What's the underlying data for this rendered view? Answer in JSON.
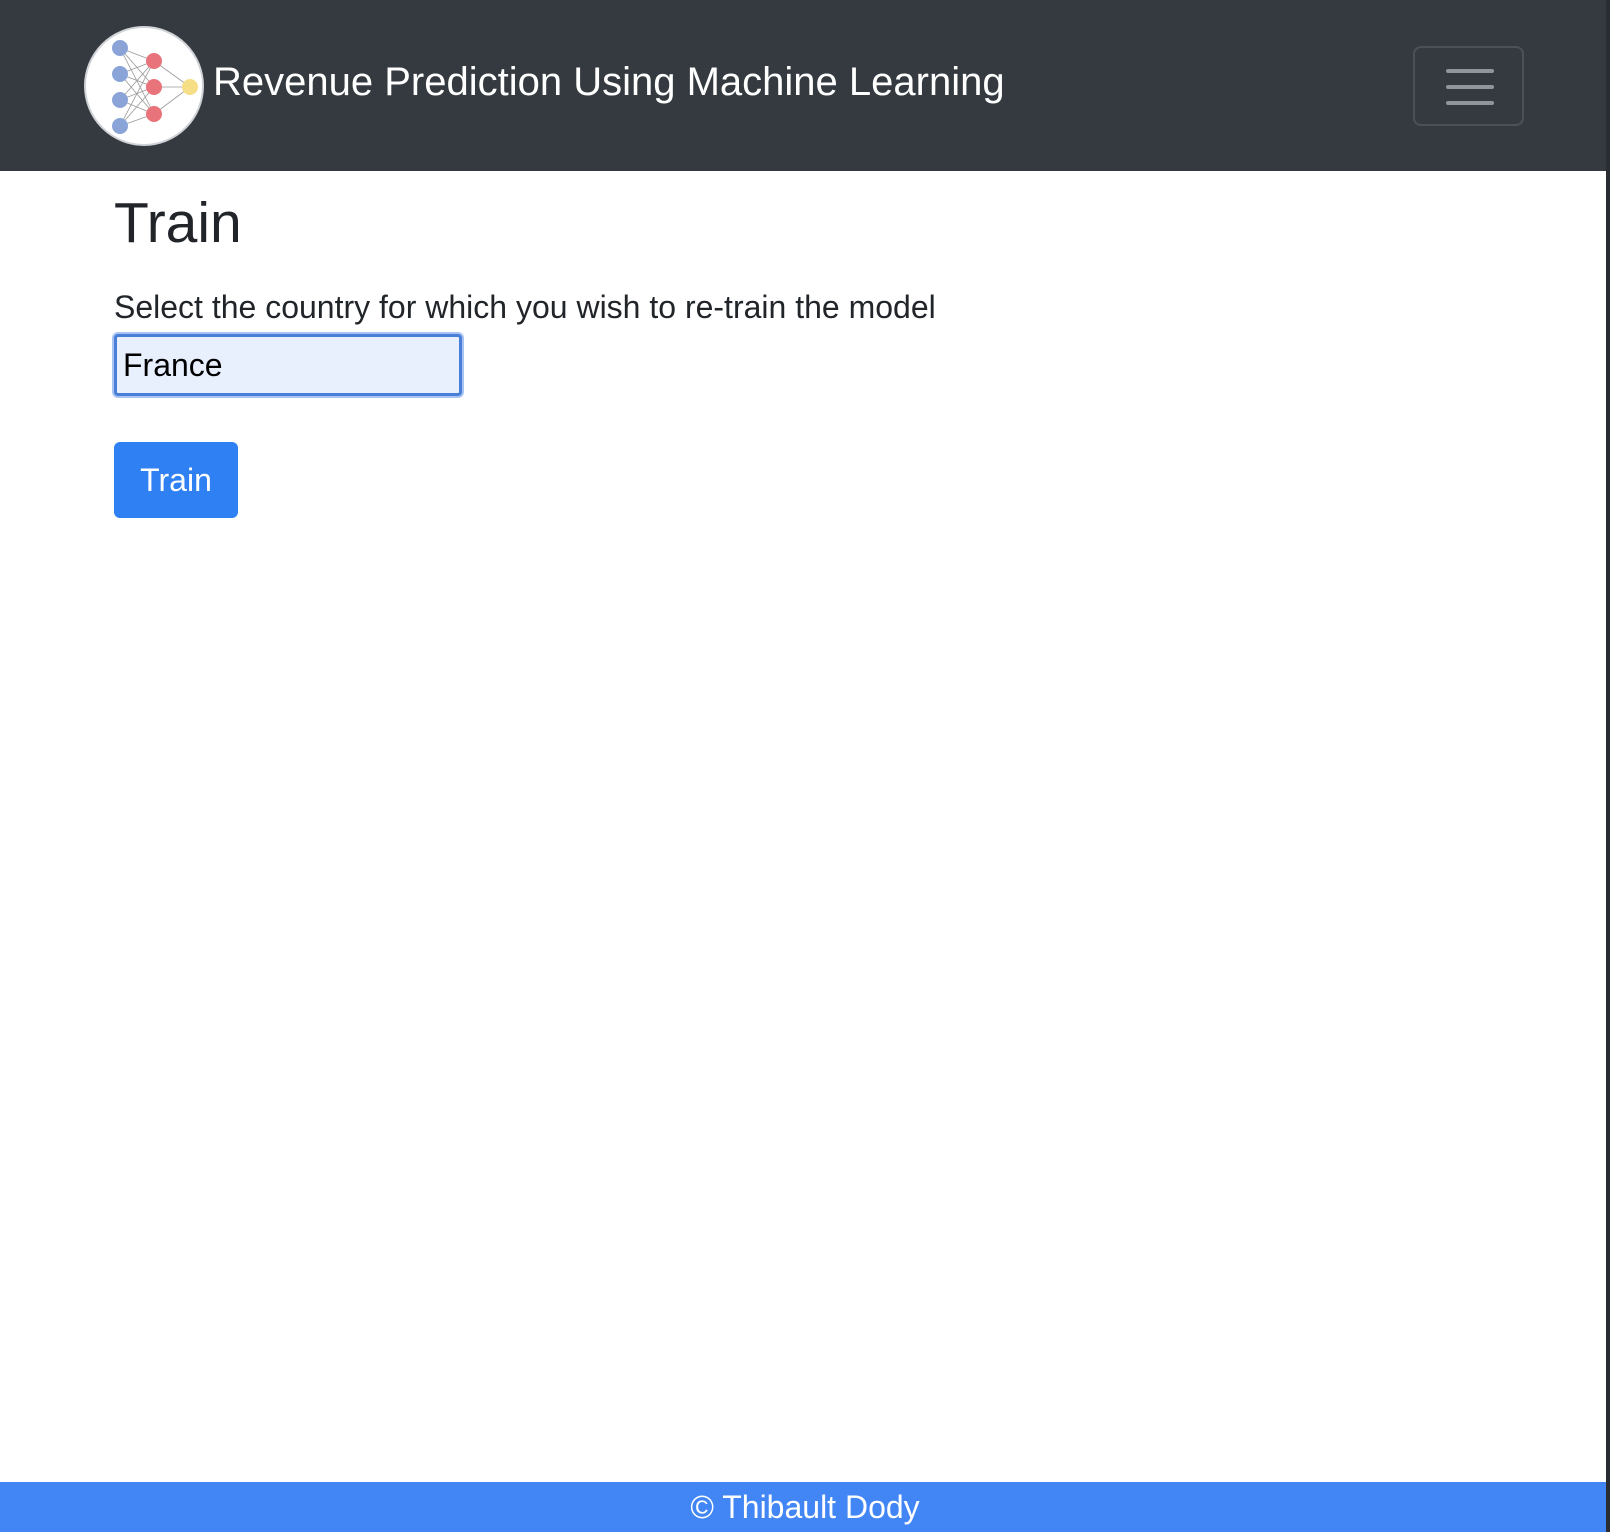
{
  "header": {
    "brand_title": "Revenue Prediction Using Machine Learning",
    "logo_icon": "neural-network-icon",
    "menu_icon": "hamburger-menu-icon"
  },
  "main": {
    "page_title": "Train",
    "country_label": "Select the country for which you wish to re-train the model",
    "country_selected": "France",
    "train_button_label": "Train"
  },
  "footer": {
    "text": "© Thibault Dody"
  },
  "colors": {
    "navbar": "#343a40",
    "primary_button": "#2f80f3",
    "footer": "#4285f4",
    "select_background": "#e8effd",
    "logo_input_nodes": "#8aa4d8",
    "logo_hidden_nodes": "#e8737a",
    "logo_output_node": "#f6de86"
  }
}
